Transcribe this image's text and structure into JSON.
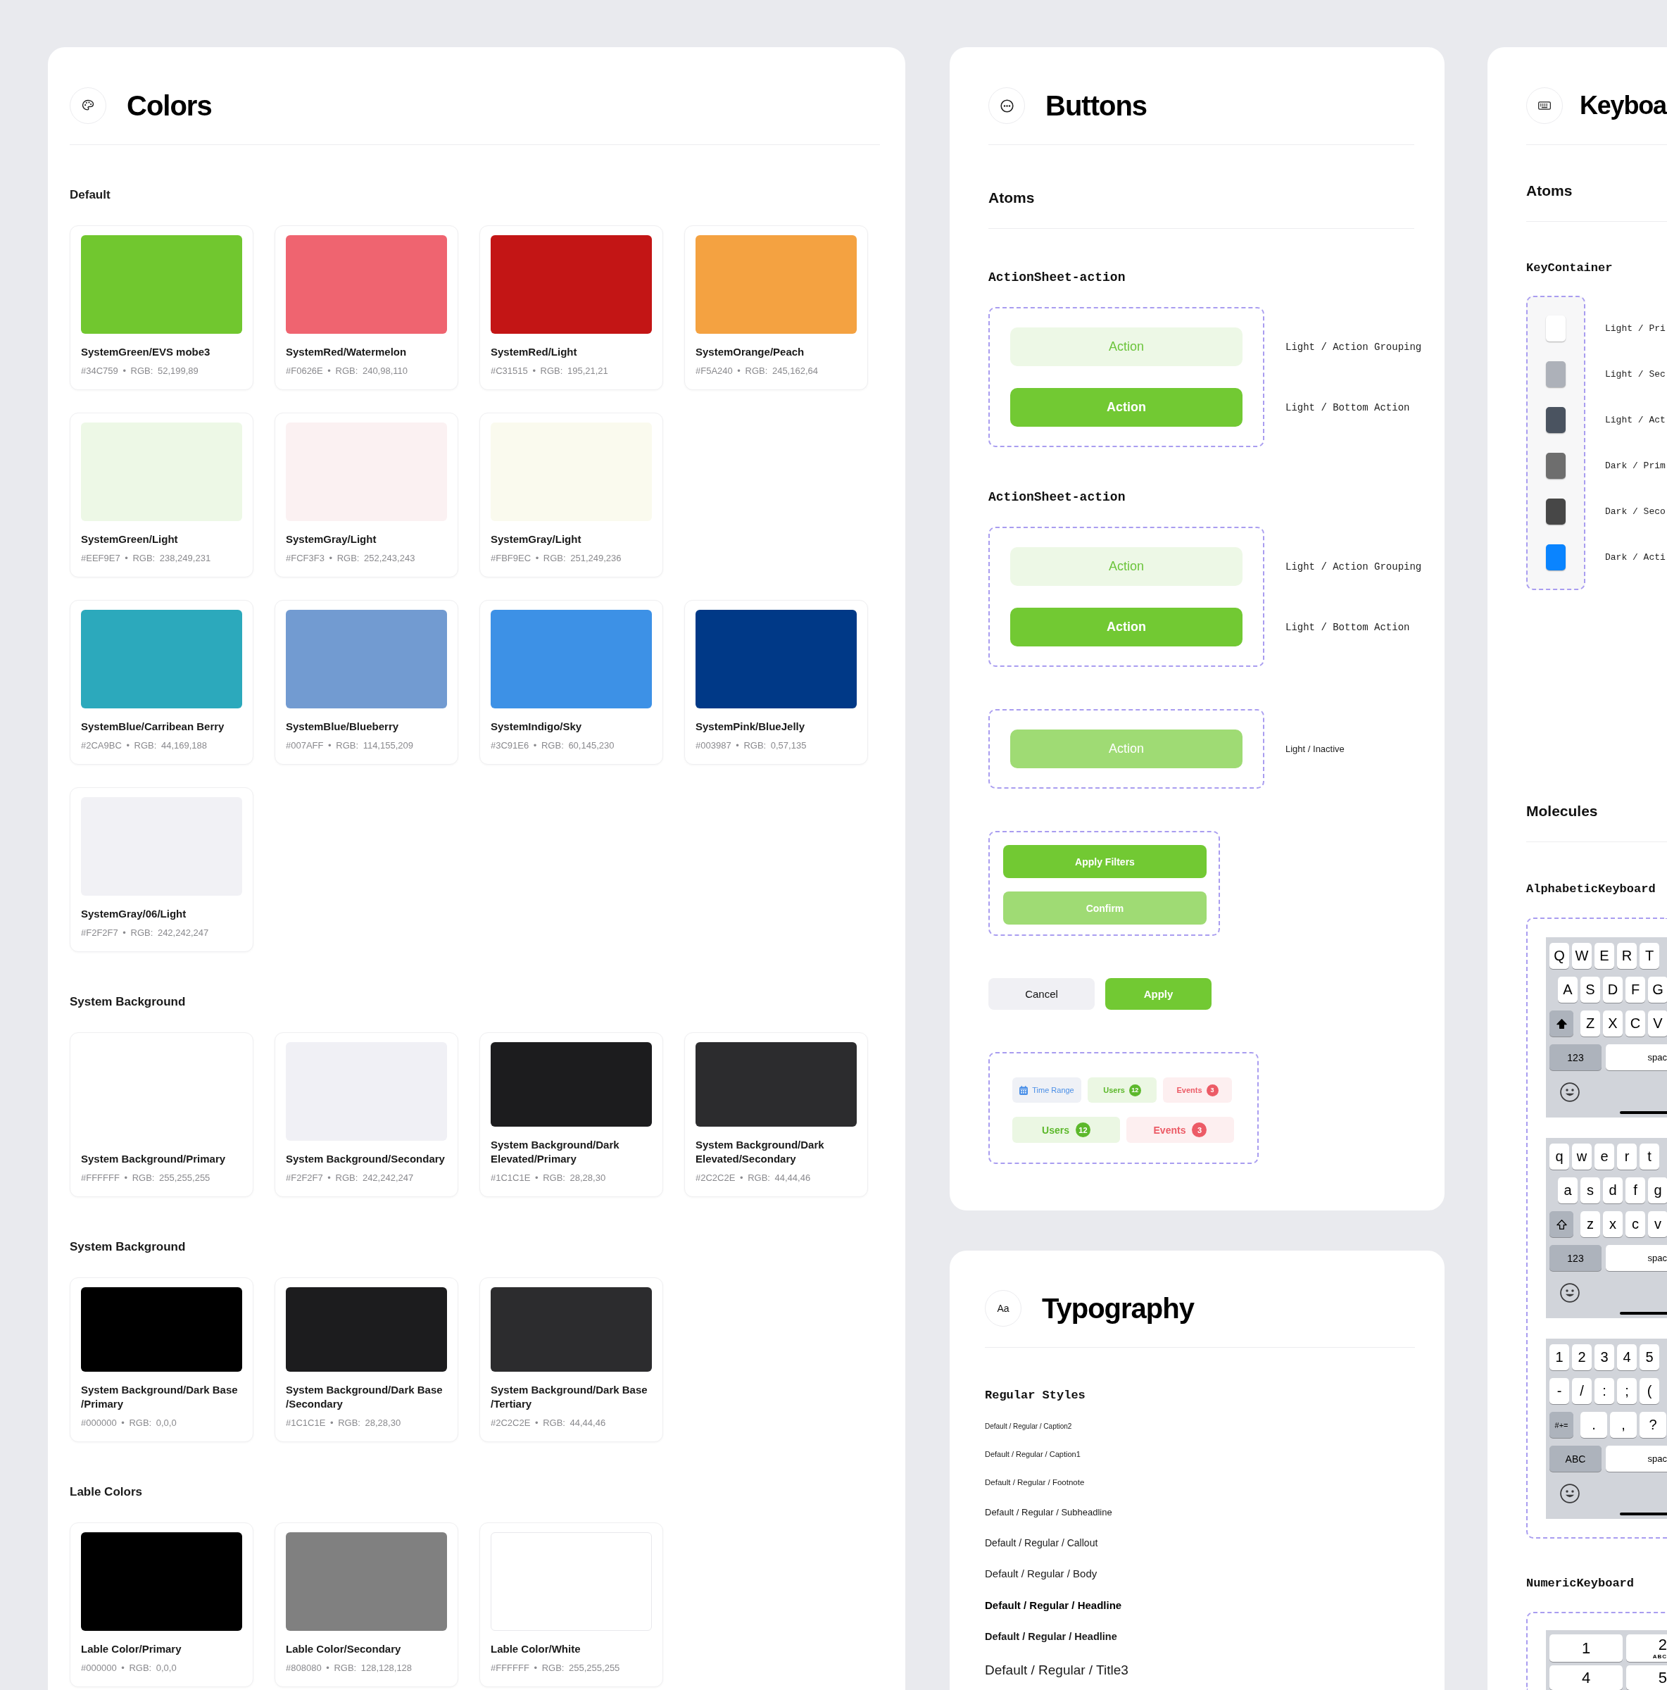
{
  "colors": {
    "title": "Colors",
    "sections": [
      {
        "heading": "Default",
        "rows": [
          {
            "cards": [
              {
                "kind": "swatch",
                "name": "SystemGreen/EVS mobe3",
                "values": "#34C759 • RGB: 52,199,89",
                "color": "#71c72f"
              },
              {
                "kind": "swatch",
                "name": "SystemRed/Watermelon",
                "values": "#F0626E • RGB: 240,98,110",
                "color": "#ef6470"
              },
              {
                "kind": "swatch",
                "name": "SystemRed/Light",
                "values": "#C31515 • RGB: 195,21,21",
                "color": "#c31515"
              },
              {
                "kind": "swatch",
                "name": "SystemOrange/Peach",
                "values": "#F5A240 • RGB: 245,162,64",
                "color": "#f4a241"
              }
            ]
          },
          {
            "cards": [
              {
                "kind": "swatch",
                "name": "SystemGreen/Light",
                "values": "#EEF9E7 • RGB: 238,249,231",
                "color": "#edf8e6"
              },
              {
                "kind": "swatch",
                "name": "SystemGray/Light",
                "values": "#FCF3F3 • RGB: 252,243,243",
                "color": "#fbf1f2"
              },
              {
                "kind": "swatch",
                "name": "SystemGray/Light",
                "values": "#FBF9EC • RGB: 251,249,236",
                "color": "#fafaee"
              }
            ]
          },
          {
            "cards": [
              {
                "kind": "swatch",
                "name": "SystemBlue/Carribean Berry",
                "values": "#2CA9BC • RGB: 44,169,188",
                "color": "#2ca9bc"
              },
              {
                "kind": "swatch",
                "name": "SystemBlue/Blueberry",
                "values": "#007AFF • RGB: 114,155,209",
                "color": "#729bd1"
              },
              {
                "kind": "swatch",
                "name": "SystemIndigo/Sky",
                "values": "#3C91E6 • RGB: 60,145,230",
                "color": "#3d91e6"
              },
              {
                "kind": "swatch",
                "name": "SystemPink/BlueJelly",
                "values": "#003987 • RGB: 0,57,135",
                "color": "#003987"
              }
            ]
          },
          {
            "cards": [
              {
                "kind": "swatch",
                "name": "SystemGray/06/Light",
                "values": "#F2F2F7 • RGB: 242,242,247",
                "color": "#f1f1f5"
              }
            ]
          }
        ]
      },
      {
        "heading": "System Background",
        "rows": [
          {
            "cards": [
              {
                "kind": "blank",
                "name": "System Background/Primary",
                "values": "#FFFFFF • RGB: 255,255,255"
              },
              {
                "kind": "swatch",
                "name": "System Background/Secondary",
                "values": "#F2F2F7 • RGB: 242,242,247",
                "color": "#f0f0f5"
              },
              {
                "kind": "swatch",
                "name": "System Background/Dark Elevated/Primary",
                "values": "#1C1C1E • RGB: 28,28,30",
                "color": "#1c1c1e"
              },
              {
                "kind": "swatch",
                "name": "System Background/Dark Elevated/Secondary",
                "values": "#2C2C2E • RGB: 44,44,46",
                "color": "#2c2c2e"
              }
            ]
          }
        ]
      },
      {
        "heading": "System Background",
        "rows": [
          {
            "cards": [
              {
                "kind": "swatch",
                "name": "System Background/Dark Base /Primary",
                "values": "#000000 • RGB: 0,0,0",
                "color": "#000000"
              },
              {
                "kind": "swatch",
                "name": "System Background/Dark Base /Secondary",
                "values": "#1C1C1E • RGB: 28,28,30",
                "color": "#1c1c1e"
              },
              {
                "kind": "swatch",
                "name": "System Background/Dark Base /Tertiary",
                "values": "#2C2C2E • RGB: 44,44,46",
                "color": "#2c2c2e"
              }
            ]
          }
        ]
      },
      {
        "heading": "Lable Colors",
        "rows": [
          {
            "cards": [
              {
                "kind": "swatch",
                "name": "Lable Color/Primary",
                "values": "#000000 • RGB: 0,0,0",
                "color": "#000000"
              },
              {
                "kind": "swatch",
                "name": "Lable Color/Secondary",
                "values": "#808080 • RGB: 128,128,128",
                "color": "#808080"
              },
              {
                "kind": "outlined",
                "name": "Lable Color/White",
                "values": "#FFFFFF • RGB: 255,255,255",
                "color": "#ffffff"
              }
            ]
          }
        ]
      }
    ]
  },
  "buttons": {
    "title": "Buttons",
    "heading": "Atoms",
    "groups": [
      {
        "kind": "sheet",
        "label": "ActionSheet-action",
        "items": [
          {
            "kind": "grouping",
            "text": "Action",
            "note": "Light / Action Grouping"
          },
          {
            "kind": "bottom",
            "text": "Action",
            "note": "Light / Bottom Action"
          }
        ]
      },
      {
        "kind": "sheet",
        "label": "ActionSheet-action",
        "items": [
          {
            "kind": "grouping",
            "text": "Action",
            "note": "Light / Action Grouping"
          },
          {
            "kind": "bottom",
            "text": "Action",
            "note": "Light / Bottom Action"
          }
        ]
      },
      {
        "kind": "sheet",
        "items": [
          {
            "kind": "inactive",
            "text": "Action",
            "note": "Light / Inactive"
          }
        ]
      },
      {
        "kind": "stack",
        "items": [
          {
            "kind": "bottom",
            "text": "Apply Filters"
          },
          {
            "kind": "inactive",
            "text": "Confirm"
          }
        ]
      },
      {
        "kind": "pair",
        "items": [
          {
            "kind": "secondary",
            "text": "Cancel"
          },
          {
            "kind": "bottom",
            "text": "Apply"
          }
        ]
      },
      {
        "kind": "chips",
        "rows": [
          {
            "kind": "small",
            "chips": [
              {
                "kind": "date",
                "text": "Time Range"
              },
              {
                "kind": "success",
                "text": "Users",
                "count": "12"
              },
              {
                "kind": "danger",
                "text": "Events",
                "count": "3"
              }
            ]
          },
          {
            "kind": "large",
            "chips": [
              {
                "kind": "success",
                "text": "Users",
                "count": "12"
              },
              {
                "kind": "danger",
                "text": "Events",
                "count": "3"
              }
            ]
          }
        ]
      }
    ]
  },
  "typography": {
    "title": "Typography",
    "badge": "Aa",
    "heading": "Regular Styles",
    "styles": [
      {
        "kind": "caption2",
        "text": "Default / Regular / Caption2"
      },
      {
        "kind": "caption1",
        "text": "Default / Regular / Caption1"
      },
      {
        "kind": "footnote",
        "text": "Default / Regular / Footnote"
      },
      {
        "kind": "subheadline",
        "text": "Default / Regular / Subheadline"
      },
      {
        "kind": "callout",
        "text": "Default / Regular / Callout"
      },
      {
        "kind": "body",
        "text": "Default / Regular / Body"
      },
      {
        "kind": "headline",
        "text": "Default / Regular / Headline"
      },
      {
        "kind": "emphasized",
        "text": "Default / Regular / Headline"
      },
      {
        "kind": "title3",
        "text": "Default / Regular / Title3"
      }
    ]
  },
  "keyboard": {
    "title": "Keyboa",
    "atoms_heading": "Atoms",
    "key_container": {
      "label": "KeyContainer",
      "keys": [
        {
          "color": "#ffffff",
          "note": "Light / Pri"
        },
        {
          "color": "#adb1b9",
          "note": "Light / Sec"
        },
        {
          "color": "#4a5360",
          "note": "Light / Act"
        },
        {
          "color": "#6e6e6e",
          "note": "Dark / Prim"
        },
        {
          "color": "#474747",
          "note": "Dark / Seco"
        },
        {
          "color": "#0a84ff",
          "note": "Dark / Acti"
        }
      ]
    },
    "molecules_heading": "Molecules",
    "alphabetic": {
      "label": "AlphabeticKeyboard",
      "keyboards": [
        {
          "kind": "letters",
          "rows": [
            {
              "keys": [
                {
                  "kind": "char",
                  "text": "Q"
                },
                {
                  "kind": "char",
                  "text": "W"
                },
                {
                  "kind": "char",
                  "text": "E"
                },
                {
                  "kind": "char",
                  "text": "R"
                },
                {
                  "kind": "char",
                  "text": "T"
                }
              ]
            },
            {
              "keys": [
                {
                  "kind": "char",
                  "text": "A"
                },
                {
                  "kind": "char",
                  "text": "S"
                },
                {
                  "kind": "char",
                  "text": "D"
                },
                {
                  "kind": "char",
                  "text": "F"
                },
                {
                  "kind": "char",
                  "text": "G"
                }
              ]
            },
            {
              "keys": [
                {
                  "kind": "shift",
                  "on": true
                },
                {
                  "kind": "char",
                  "text": "Z"
                },
                {
                  "kind": "char",
                  "text": "X"
                },
                {
                  "kind": "char",
                  "text": "C"
                },
                {
                  "kind": "char",
                  "text": "V"
                }
              ]
            },
            {
              "keys": [
                {
                  "kind": "mode",
                  "text": "123"
                },
                {
                  "kind": "space",
                  "text": "spac"
                }
              ]
            }
          ]
        },
        {
          "kind": "letters",
          "rows": [
            {
              "keys": [
                {
                  "kind": "char",
                  "text": "q"
                },
                {
                  "kind": "char",
                  "text": "w"
                },
                {
                  "kind": "char",
                  "text": "e"
                },
                {
                  "kind": "char",
                  "text": "r"
                },
                {
                  "kind": "char",
                  "text": "t"
                }
              ]
            },
            {
              "keys": [
                {
                  "kind": "char",
                  "text": "a"
                },
                {
                  "kind": "char",
                  "text": "s"
                },
                {
                  "kind": "char",
                  "text": "d"
                },
                {
                  "kind": "char",
                  "text": "f"
                },
                {
                  "kind": "char",
                  "text": "g"
                }
              ]
            },
            {
              "keys": [
                {
                  "kind": "shift",
                  "on": false
                },
                {
                  "kind": "char",
                  "text": "z"
                },
                {
                  "kind": "char",
                  "text": "x"
                },
                {
                  "kind": "char",
                  "text": "c"
                },
                {
                  "kind": "char",
                  "text": "v"
                }
              ]
            },
            {
              "keys": [
                {
                  "kind": "mode",
                  "text": "123"
                },
                {
                  "kind": "space",
                  "text": "spac"
                }
              ]
            }
          ]
        },
        {
          "kind": "numbers",
          "rows": [
            {
              "keys": [
                {
                  "kind": "char",
                  "text": "1"
                },
                {
                  "kind": "char",
                  "text": "2"
                },
                {
                  "kind": "char",
                  "text": "3"
                },
                {
                  "kind": "char",
                  "text": "4"
                },
                {
                  "kind": "char",
                  "text": "5"
                }
              ]
            },
            {
              "keys": [
                {
                  "kind": "char",
                  "text": "-"
                },
                {
                  "kind": "char",
                  "text": "/"
                },
                {
                  "kind": "char",
                  "text": ":"
                },
                {
                  "kind": "char",
                  "text": ";"
                },
                {
                  "kind": "char",
                  "text": "("
                }
              ]
            },
            {
              "keys": [
                {
                  "kind": "symbols",
                  "text": "#+="
                },
                {
                  "kind": "punct",
                  "text": "."
                },
                {
                  "kind": "punct",
                  "text": ","
                },
                {
                  "kind": "punct",
                  "text": "?"
                }
              ]
            },
            {
              "keys": [
                {
                  "kind": "mode",
                  "text": "ABC"
                },
                {
                  "kind": "space",
                  "text": "spac"
                }
              ]
            }
          ]
        }
      ]
    },
    "numeric": {
      "label": "NumericKeyboard",
      "rows": [
        {
          "keys": [
            {
              "digit": "1"
            },
            {
              "digit": "2",
              "letters": "ABC"
            }
          ]
        },
        {
          "keys": [
            {
              "digit": "4"
            },
            {
              "digit": "5"
            }
          ]
        }
      ]
    }
  }
}
